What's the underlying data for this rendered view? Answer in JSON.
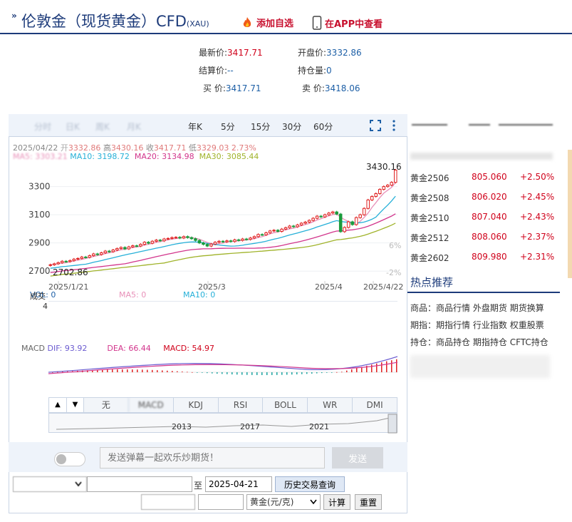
{
  "header": {
    "arrows": "»",
    "title": "伦敦金（现货黄金）CFD",
    "title_sub": "(XAU)",
    "fav_label": "添加自选",
    "app_label": "在APP中查看"
  },
  "quote": {
    "latest_label": "最新价:",
    "latest_value": "3417.71",
    "open_label": "开盘价:",
    "open_value": "3332.86",
    "settle_label": "结算价:",
    "settle_value": "--",
    "oi_label": "持仓量:",
    "oi_value": "0",
    "bid_label": "买  价:",
    "bid_value": "3417.71",
    "ask_label": "卖  价:",
    "ask_value": "3418.06"
  },
  "tabs": {
    "blurred": [
      "分时",
      "日K",
      "周K",
      "月K"
    ],
    "items": [
      "年K",
      "5分",
      "15分",
      "30分",
      "60分"
    ]
  },
  "info_line": {
    "date": "2025/04/22",
    "open_label": "开",
    "open_value": "3332.86",
    "high_label": "高",
    "high_value": "3430.16",
    "close_label": "收",
    "close_value": "3417.71",
    "low_label": "低",
    "low_value": "3329.03",
    "change_pct": "2.73%"
  },
  "ma_line": {
    "ma5": "MA5: 3303.21",
    "ma10": "MA10: 3198.72",
    "ma20": "MA20: 3134.98",
    "ma30": "MA30: 3085.44"
  },
  "chart_data": {
    "type": "candlestick",
    "x_labels": [
      "2025/1/21",
      "2025/3",
      "2025/4",
      "2025/4/22"
    ],
    "y_ticks": [
      3300,
      3100,
      2900,
      2700
    ],
    "ylim": [
      2620,
      3450
    ],
    "max_label": "3430.16",
    "min_label": "2702.86",
    "pct_ticks": [
      "6%",
      "-2%"
    ],
    "closes": [
      2745,
      2752,
      2760,
      2770,
      2768,
      2775,
      2785,
      2790,
      2800,
      2798,
      2810,
      2822,
      2818,
      2830,
      2842,
      2838,
      2850,
      2860,
      2868,
      2858,
      2872,
      2880,
      2878,
      2890,
      2905,
      2898,
      2912,
      2920,
      2915,
      2928,
      2932,
      2938,
      2940,
      2935,
      2945,
      2938,
      2930,
      2918,
      2900,
      2890,
      2878,
      2892,
      2905,
      2912,
      2908,
      2915,
      2910,
      2922,
      2918,
      2928,
      2925,
      2935,
      2945,
      2960,
      2958,
      2972,
      2985,
      2990,
      2982,
      2998,
      3008,
      3020,
      3015,
      3028,
      3040,
      3048,
      3060,
      3075,
      3090,
      3085,
      3100,
      3112,
      3120,
      3105,
      2980,
      3010,
      3050,
      3030,
      3080,
      3100,
      3145,
      3205,
      3230,
      3250,
      3280,
      3300,
      3310,
      3330,
      3417
    ],
    "ma_series": [
      {
        "name": "MA5",
        "color": "#e891b9"
      },
      {
        "name": "MA10",
        "color": "#26b0d8"
      },
      {
        "name": "MA20",
        "color": "#d2358c"
      },
      {
        "name": "MA30",
        "color": "#a0b32a"
      }
    ]
  },
  "volume": {
    "label": "成交",
    "sub": "4",
    "vol": "VOL: 0",
    "ma5": "MA5: 0",
    "ma10": "MA10: 0"
  },
  "macd": {
    "label": "MACD",
    "dif": "DIF: 93.92",
    "dea": "DEA: 66.44",
    "macd": "MACD: 54.97"
  },
  "indicators": {
    "up": "▲",
    "down": "▼",
    "items": [
      "无",
      "MACD",
      "KDJ",
      "RSI",
      "BOLL",
      "WR",
      "DMI"
    ]
  },
  "timeline_labels": [
    "2013",
    "2017",
    "2021"
  ],
  "chat": {
    "placeholder": "发送弹幕一起欢乐炒期货！",
    "send_label": "发送"
  },
  "query": {
    "to_label": "至",
    "end_date": "2025-04-21",
    "history_btn": "历史交易查询",
    "unit_option": "黄金(元/克)",
    "calc_btn": "计算",
    "reset_btn": "重置"
  },
  "right_panel": {
    "rows": [
      {
        "name": "黄金2506",
        "price": "805.060",
        "chg": "+2.50%"
      },
      {
        "name": "黄金2508",
        "price": "806.020",
        "chg": "+2.45%"
      },
      {
        "name": "黄金2510",
        "price": "807.040",
        "chg": "+2.43%"
      },
      {
        "name": "黄金2512",
        "price": "808.060",
        "chg": "+2.37%"
      },
      {
        "name": "黄金2602",
        "price": "809.980",
        "chg": "+2.31%"
      }
    ],
    "hot_title": "热点推荐",
    "hot": [
      {
        "label": "商品：",
        "links": [
          "商品行情",
          "外盘期货",
          "期货换算"
        ]
      },
      {
        "label": "期指：",
        "links": [
          "期指行情",
          "行业指数",
          "权重股票"
        ]
      },
      {
        "label": "持仓：",
        "links": [
          "商品持仓",
          "期指持仓",
          "CFTC持仓"
        ]
      }
    ]
  }
}
